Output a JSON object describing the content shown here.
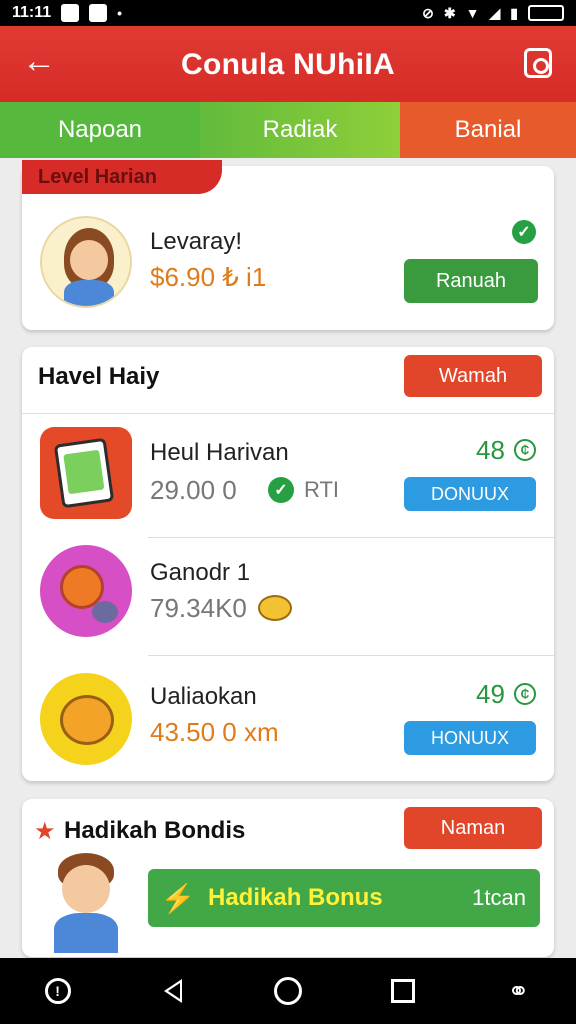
{
  "status_bar": {
    "time": "11:11"
  },
  "app_bar": {
    "title": "Conula NUhiIA"
  },
  "tabs": [
    {
      "label": "Napoan"
    },
    {
      "label": "Radiak"
    },
    {
      "label": "Banial"
    }
  ],
  "level_card": {
    "ribbon": "Level Harian",
    "name": "Levaray!",
    "amount": "$6.90 ₺ i1",
    "button": "Ranuah"
  },
  "daily_card": {
    "title": "Havel Haiy",
    "header_button": "Wamah",
    "items": [
      {
        "title": "Heul Harivan",
        "amount": "29.00 0",
        "suffix": "RTI",
        "points": "48",
        "button": "DONUUX"
      },
      {
        "title": "Ganodr 1",
        "amount": "79.34K0"
      },
      {
        "title": "Ualiaokan",
        "amount": "43.50 0 xm",
        "points": "49",
        "button": "HONUUX"
      }
    ]
  },
  "bonus_card": {
    "title": "Hadikah Bondis",
    "header_button": "Naman",
    "bar_label": "Hadikah Bonus",
    "bar_suffix": "1tcan"
  },
  "colors": {
    "app_bar": "#d62b27",
    "tab_left": "#56b93e",
    "tab_right": "#e65a2b",
    "button_green": "#3a9a3e",
    "button_red": "#e2462a",
    "button_blue": "#2d9be2"
  }
}
